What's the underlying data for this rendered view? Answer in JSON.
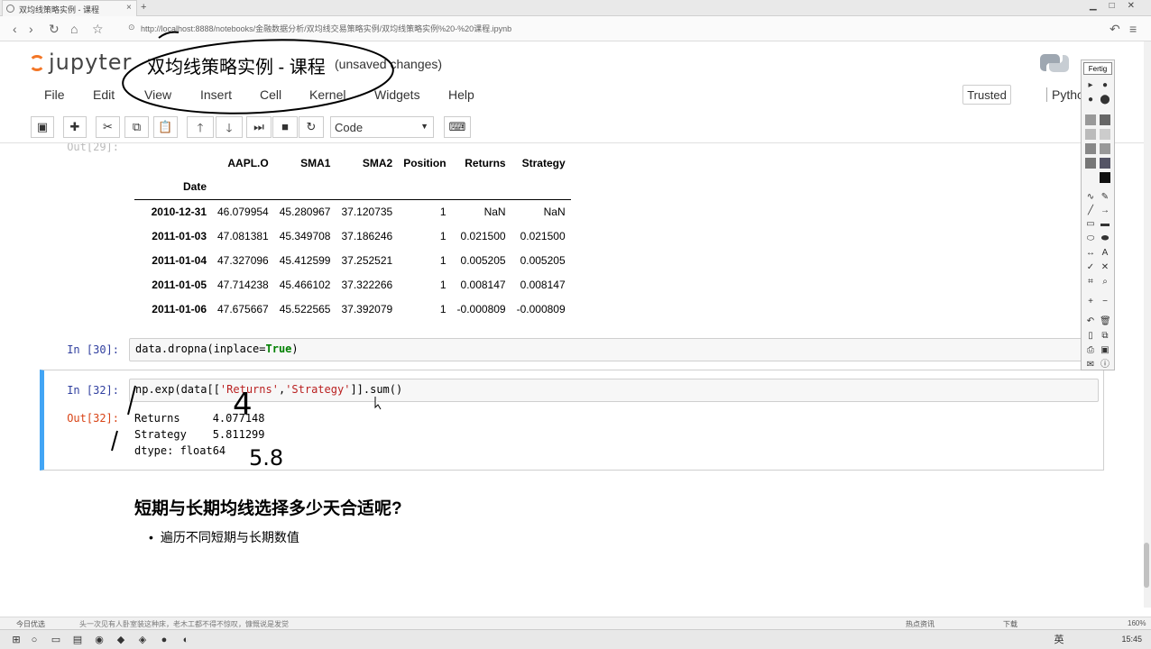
{
  "browser": {
    "tab_title": "双均线策略实例 - 课程",
    "url": "http://localhost:8888/notebooks/金融数据分析/双均线交易策略实例/双均线策略实例%20-%20课程.ipynb"
  },
  "header": {
    "logo_text": "jupyter",
    "notebook_title": "双均线策略实例 - 课程",
    "save_status": "(unsaved changes)"
  },
  "menu": {
    "items": [
      "File",
      "Edit",
      "View",
      "Insert",
      "Cell",
      "Kernel",
      "Widgets",
      "Help"
    ],
    "trusted": "Trusted",
    "kernel": "Pytho"
  },
  "toolbar": {
    "cell_type": "Code"
  },
  "cells": {
    "out29_prompt": "Out[29]:",
    "table": {
      "columns": [
        "AAPL.O",
        "SMA1",
        "SMA2",
        "Position",
        "Returns",
        "Strategy"
      ],
      "index_name": "Date",
      "rows": [
        {
          "date": "2010-12-31",
          "values": [
            "46.079954",
            "45.280967",
            "37.120735",
            "1",
            "NaN",
            "NaN"
          ]
        },
        {
          "date": "2011-01-03",
          "values": [
            "47.081381",
            "45.349708",
            "37.186246",
            "1",
            "0.021500",
            "0.021500"
          ]
        },
        {
          "date": "2011-01-04",
          "values": [
            "47.327096",
            "45.412599",
            "37.252521",
            "1",
            "0.005205",
            "0.005205"
          ]
        },
        {
          "date": "2011-01-05",
          "values": [
            "47.714238",
            "45.466102",
            "37.322266",
            "1",
            "0.008147",
            "0.008147"
          ]
        },
        {
          "date": "2011-01-06",
          "values": [
            "47.675667",
            "45.522565",
            "37.392079",
            "1",
            "-0.000809",
            "-0.000809"
          ]
        }
      ]
    },
    "in30_prompt": "In [30]:",
    "in30_code": {
      "a": "data.dropna(inplace=",
      "kw": "True",
      "b": ")"
    },
    "in32_prompt": "In [32]:",
    "in32_code": {
      "a": "np.exp(data[[",
      "s1": "'Returns'",
      "c": ",",
      "s2": "'Strategy'",
      "d": "]].sum()"
    },
    "out32_prompt": "Out[32]:",
    "out32_lines": [
      "Returns     4.077148",
      "Strategy    5.811299",
      "dtype: float64"
    ]
  },
  "markdown": {
    "heading": "短期与长期均线选择多少天合适呢?",
    "bullet": "遍历不同短期与长期数值"
  },
  "draw_tools": {
    "label": "Fertig"
  },
  "statusbar": {
    "left": "今日优选",
    "news": "头一次见有人卧室装这种床，老木工都不得不惊叹，慷慨说是发觉",
    "right1": "热点资讯",
    "right2": "下载",
    "zoom": "160%"
  },
  "taskbar": {
    "time": "15:45",
    "lang": "英"
  },
  "annotations": {
    "handwritten_4": "4",
    "handwritten_58": "5.8"
  }
}
